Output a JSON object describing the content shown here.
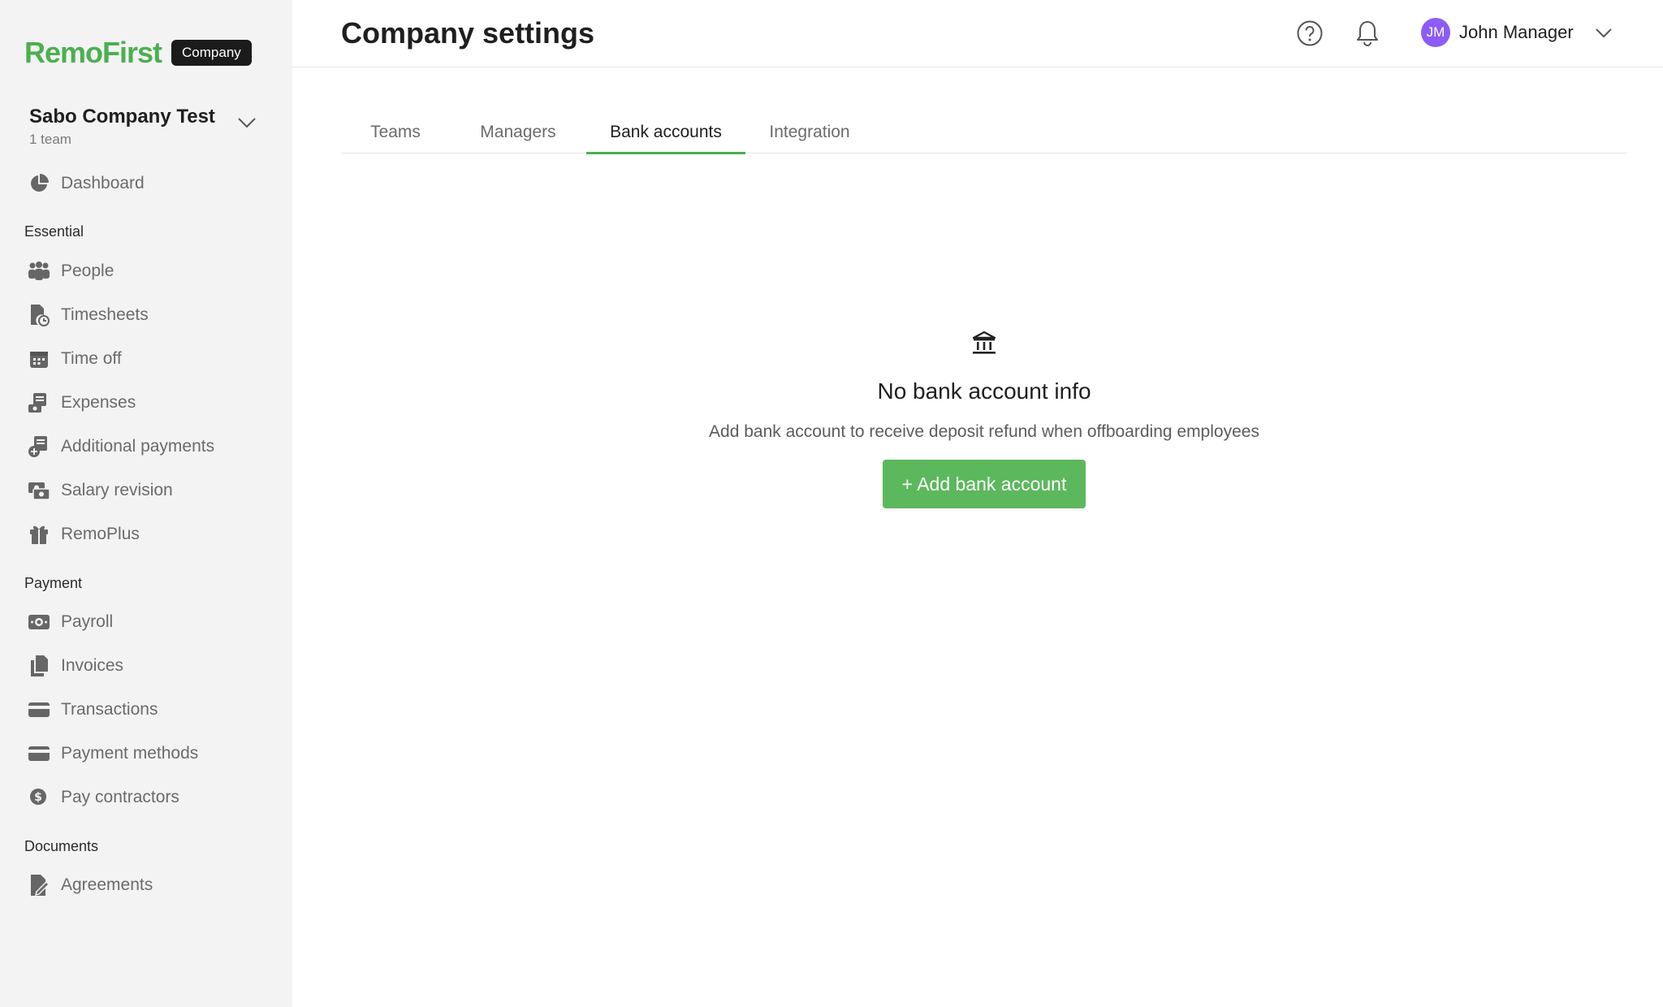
{
  "brand": {
    "logo": "RemoFirst",
    "badge": "Company"
  },
  "company": {
    "name": "Sabo Company Test",
    "sub": "1 team"
  },
  "sidebar": {
    "dashboard": "Dashboard",
    "sections": {
      "essential": "Essential",
      "payment": "Payment",
      "documents": "Documents"
    },
    "items": {
      "people": "People",
      "timesheets": "Timesheets",
      "time_off": "Time off",
      "expenses": "Expenses",
      "additional_payments": "Additional payments",
      "salary_revision": "Salary revision",
      "remoplus": "RemoPlus",
      "payroll": "Payroll",
      "invoices": "Invoices",
      "transactions": "Transactions",
      "payment_methods": "Payment methods",
      "pay_contractors": "Pay contractors",
      "agreements": "Agreements"
    }
  },
  "header": {
    "title": "Company settings",
    "user": {
      "initials": "JM",
      "name": "John Manager"
    }
  },
  "tabs": [
    "Teams",
    "Managers",
    "Bank accounts",
    "Integration"
  ],
  "active_tab": "Bank accounts",
  "empty_state": {
    "title": "No bank account info",
    "description": "Add bank account to receive deposit refund when offboarding employees",
    "button": "+ Add bank account"
  },
  "colors": {
    "accent": "#4caf50",
    "button": "#5cb85c",
    "avatar": "#8b5cf6",
    "sidebar_bg": "#f3f3f3"
  }
}
